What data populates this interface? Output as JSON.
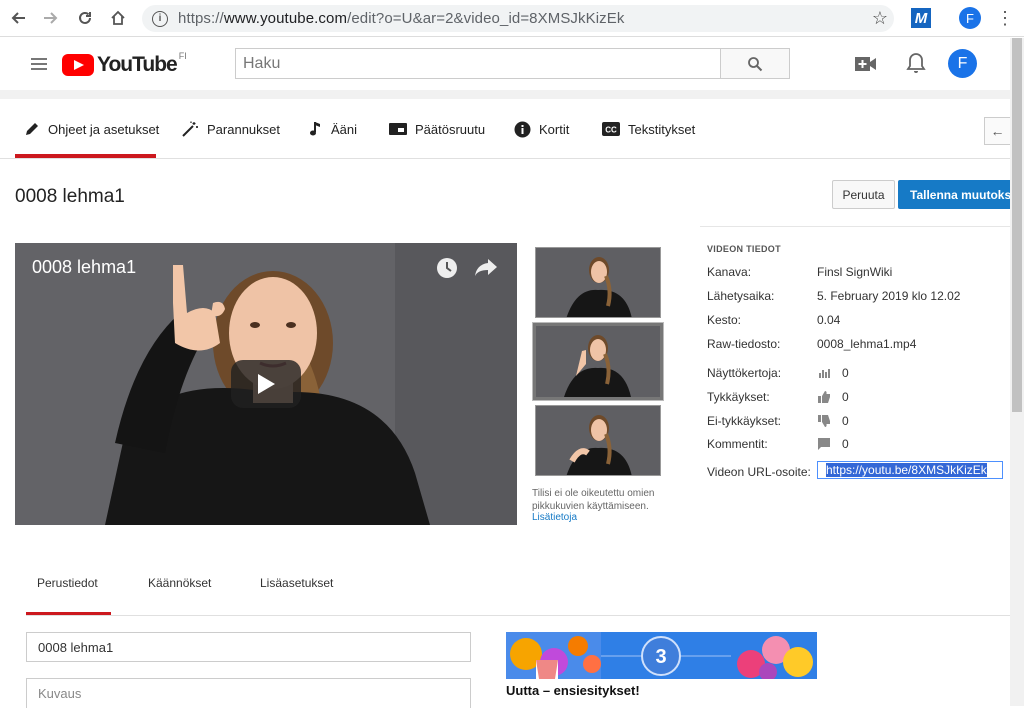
{
  "browser": {
    "url_prefix": "https://",
    "url_domain": "www.youtube.com",
    "url_path": "/edit?o=U&ar=2&video_id=8XMSJkKizEk",
    "extension_label": "M",
    "profile_initial": "F"
  },
  "header": {
    "logo_text": "YouTube",
    "region": "FI",
    "search_placeholder": "Haku",
    "avatar_initial": "F"
  },
  "editor_tabs": [
    {
      "label": "Ohjeet ja asetukset",
      "icon": "pencil-icon",
      "active": true
    },
    {
      "label": "Parannukset",
      "icon": "magic-wand-icon",
      "active": false
    },
    {
      "label": "Ääni",
      "icon": "music-note-icon",
      "active": false
    },
    {
      "label": "Päätösruutu",
      "icon": "end-screen-icon",
      "active": false
    },
    {
      "label": "Kortit",
      "icon": "info-icon",
      "active": false
    },
    {
      "label": "Tekstitykset",
      "icon": "cc-icon",
      "active": false
    }
  ],
  "title_row": {
    "video_title": "0008 lehma1",
    "cancel_label": "Peruuta",
    "save_label": "Tallenna muutokset"
  },
  "player": {
    "title": "0008 lehma1"
  },
  "thumbnails": {
    "note": "Tilisi ei ole oikeutettu omien pikkukuvien käyttämiseen.",
    "link": "Lisätietoja",
    "selected_index": 1
  },
  "video_info": {
    "heading": "VIDEON TIEDOT",
    "rows": [
      {
        "label": "Kanava:",
        "value": "Finsl SignWiki"
      },
      {
        "label": "Lähetysaika:",
        "value": "5. February 2019 klo 12.02"
      },
      {
        "label": "Kesto:",
        "value": "0.04"
      },
      {
        "label": "Raw-tiedosto:",
        "value": "0008_lehma1.mp4"
      }
    ],
    "stats": [
      {
        "label": "Näyttökertoja:",
        "icon": "bar-chart-icon",
        "value": "0"
      },
      {
        "label": "Tykkäykset:",
        "icon": "thumbs-up-icon",
        "value": "0"
      },
      {
        "label": "Ei-tykkäykset:",
        "icon": "thumbs-down-icon",
        "value": "0"
      },
      {
        "label": "Kommentit:",
        "icon": "comment-icon",
        "value": "0"
      }
    ],
    "url_label": "Videon URL-osoite:",
    "url_value": "https://youtu.be/8XMSJkKizEk"
  },
  "lower_tabs": [
    {
      "label": "Perustiedot",
      "active": true
    },
    {
      "label": "Käännökset",
      "active": false
    },
    {
      "label": "Lisäasetukset",
      "active": false
    }
  ],
  "form": {
    "title_value": "0008 lehma1",
    "description_placeholder": "Kuvaus"
  },
  "promo": {
    "badge_number": "3",
    "caption": "Uutta – ensiesitykset!"
  },
  "colors": {
    "brand_red": "#ff0000",
    "tab_underline": "#cc181e",
    "primary_blue": "#167ac6"
  }
}
